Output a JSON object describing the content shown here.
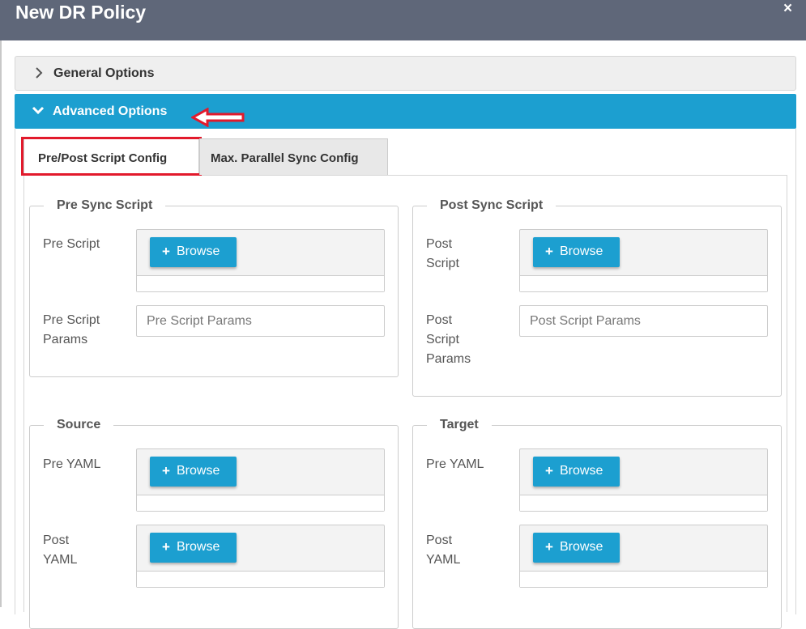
{
  "dialog": {
    "title": "New DR Policy",
    "close_glyph": "×"
  },
  "accordion": {
    "general_label": "General Options",
    "advanced_label": "Advanced Options"
  },
  "tabs": [
    {
      "label": "Pre/Post Script Config",
      "active": true
    },
    {
      "label": "Max. Parallel Sync Config",
      "active": false
    }
  ],
  "browse_label": "Browse",
  "groups": {
    "pre_sync": {
      "legend": "Pre Sync Script",
      "script_label": "Pre Script",
      "params_label": "Pre Script Params",
      "params_placeholder": "Pre Script Params"
    },
    "post_sync": {
      "legend": "Post Sync Script",
      "script_label": "Post Script",
      "params_label": "Post Script Params",
      "params_placeholder": "Post Script Params"
    },
    "source": {
      "legend": "Source",
      "pre_yaml_label": "Pre YAML",
      "post_yaml_label": "Post YAML"
    },
    "target": {
      "legend": "Target",
      "pre_yaml_label": "Pre YAML",
      "post_yaml_label": "Post YAML"
    }
  },
  "colors": {
    "header_bg": "#5f6779",
    "accent": "#1c9fd0",
    "highlight_red": "#e21a2c"
  },
  "icons": {
    "close": "close-icon",
    "general_toggle": "chevron-right-icon",
    "advanced_toggle": "chevron-down-icon",
    "browse": "plus-icon",
    "annotation": "arrow-left-icon"
  }
}
